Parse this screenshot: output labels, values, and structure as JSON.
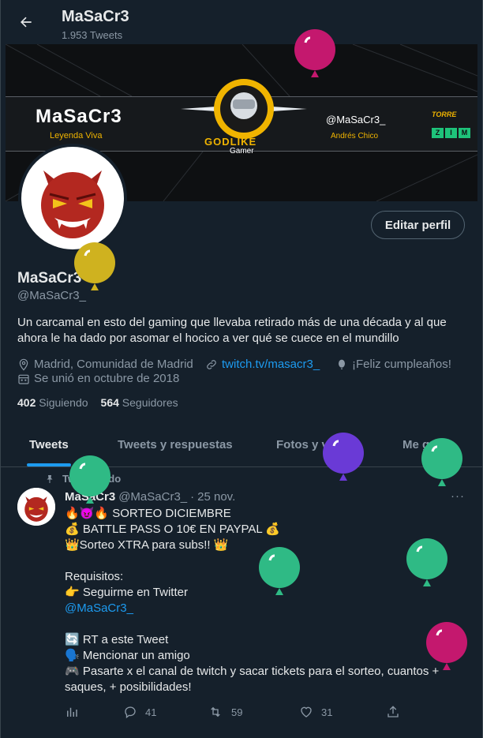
{
  "header": {
    "title": "MaSaCr3",
    "tweet_count": "1.953 Tweets"
  },
  "banner": {
    "name": "MaSaCr3",
    "subtitle": "Leyenda Viva",
    "logo_top": "GODLIKE",
    "logo_bottom": "Gamer",
    "handle": "@MaSaCr3_",
    "real_name": "Andrés Chico",
    "sponsor_1": "TORRE",
    "sponsor_2": [
      "Z",
      "I",
      "M"
    ]
  },
  "profile": {
    "edit_button": "Editar perfil",
    "name": "MaSaCr3",
    "handle": "@MaSaCr3_",
    "bio": "Un carcamal en esto del gaming que llevaba retirado más de una década y al que ahora le ha dado por asomar el hocico a ver qué se cuece en el mundillo",
    "location": "Madrid, Comunidad de Madrid",
    "website": "twitch.tv/masacr3_",
    "birthday": "¡Feliz cumpleaños!",
    "joined": "Se unió en octubre de 2018",
    "following_count": "402",
    "following_label": "Siguiendo",
    "followers_count": "564",
    "followers_label": "Seguidores"
  },
  "tabs": [
    "Tweets",
    "Tweets y respuestas",
    "Fotos y videos",
    "Me gusta"
  ],
  "tweet": {
    "pinned_label": "Tweet fijado",
    "author": "MaSaCr3",
    "handle": "@MaSaCr3_",
    "dot": "·",
    "date": "25 nov.",
    "more": "···",
    "lines": [
      "🔥😈🔥 SORTEO DICIEMBRE",
      "💰 BATTLE PASS O 10€ EN PAYPAL 💰",
      "👑Sorteo XTRA para subs!! 👑",
      "",
      "Requisitos:",
      "👉 Seguirme en Twitter",
      "@MaSaCr3_",
      "",
      "🔄 RT a este Tweet",
      "🗣️ Mencionar un amigo",
      "🎮 Pasarte x el canal de twitch y sacar tickets para el sorteo, cuantos + saques, + posibilidades!"
    ],
    "replies": "41",
    "retweets": "59",
    "likes": "31"
  },
  "colors": {
    "background": "#15202b",
    "accent": "#1d9bf0",
    "muted": "#8b98a5",
    "balloon_magenta": "#c4186e",
    "balloon_gold": "#cfb21f",
    "balloon_purple": "#6a3ad6",
    "balloon_green": "#2fba85"
  }
}
